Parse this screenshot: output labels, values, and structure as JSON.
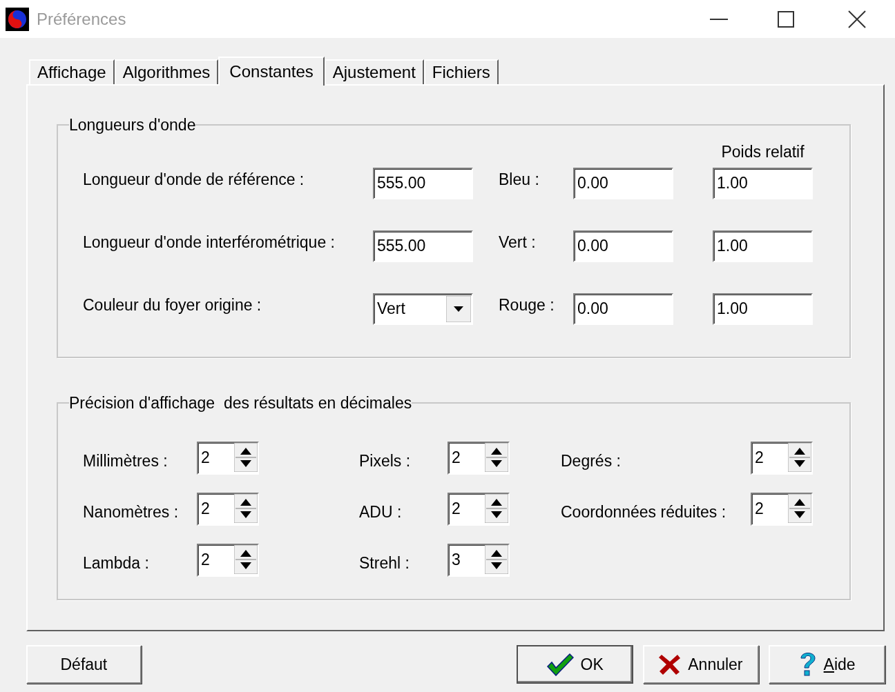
{
  "window": {
    "title": "Préférences"
  },
  "tabs": [
    {
      "label": "Affichage",
      "selected": false
    },
    {
      "label": "Algorithmes",
      "selected": false
    },
    {
      "label": "Constantes",
      "selected": true
    },
    {
      "label": "Ajustement",
      "selected": false
    },
    {
      "label": "Fichiers",
      "selected": false
    }
  ],
  "wavelengths": {
    "title": "Longueurs d'onde",
    "weight_header": "Poids relatif",
    "rows": [
      {
        "label": "Longueur d'onde de référence :",
        "kind": "field",
        "value": "555.00",
        "color_label": "Bleu :",
        "color_value": "0.00",
        "weight": "1.00"
      },
      {
        "label": "Longueur d'onde interférométrique :",
        "kind": "field",
        "value": "555.00",
        "color_label": "Vert :",
        "color_value": "0.00",
        "weight": "1.00"
      },
      {
        "label": "Couleur du foyer origine :",
        "kind": "dropdown",
        "value": "Vert",
        "color_label": "Rouge :",
        "color_value": "0.00",
        "weight": "1.00"
      }
    ]
  },
  "precision": {
    "title": "Précision d'affichage  des résultats en décimales",
    "columns": [
      [
        {
          "label": "Millimètres :",
          "value": "2"
        },
        {
          "label": "Nanomètres :",
          "value": "2"
        },
        {
          "label": "Lambda :",
          "value": "2"
        }
      ],
      [
        {
          "label": "Pixels :",
          "value": "2"
        },
        {
          "label": "ADU :",
          "value": "2"
        },
        {
          "label": "Strehl :",
          "value": "3"
        }
      ],
      [
        {
          "label": "Degrés :",
          "value": "2"
        },
        {
          "label": "Coordonnées réduites :",
          "value": "2"
        }
      ]
    ]
  },
  "buttons": [
    {
      "label": "Défaut",
      "kind": "plain",
      "default": false,
      "underlined_initial": false
    },
    {
      "label": "OK",
      "kind": "ok",
      "default": true,
      "underlined_initial": false
    },
    {
      "label": "Annuler",
      "kind": "cancel",
      "default": false,
      "underlined_initial": false
    },
    {
      "label": "Aide",
      "kind": "help",
      "default": false,
      "underlined_initial": true
    }
  ]
}
